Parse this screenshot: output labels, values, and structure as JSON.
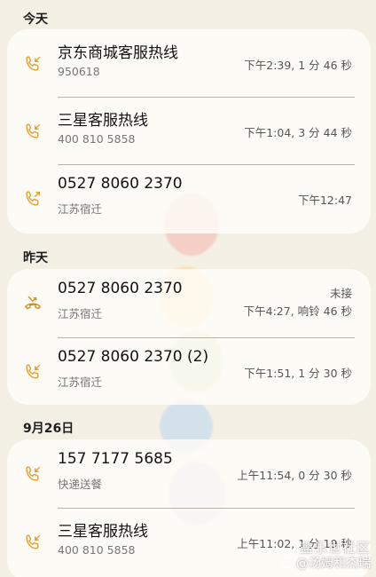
{
  "colors": {
    "background": "#f5f0e6",
    "card": "#fffdf8",
    "call_icon": "#e4a238",
    "missed_icon": "#d6902a"
  },
  "sections": [
    {
      "header": "今天",
      "calls": [
        {
          "name": "京东商城客服热线",
          "sub": "950618",
          "time": "下午2:39, 1 分 46 秒",
          "icon": "incoming-call-icon"
        },
        {
          "name": "三星客服热线",
          "sub": "400 810 5858",
          "time": "下午1:04, 3 分 44 秒",
          "icon": "incoming-call-icon"
        },
        {
          "name": "0527 8060 2370",
          "sub": "江苏宿迁",
          "time": "下午12:47",
          "icon": "outgoing-call-icon"
        }
      ]
    },
    {
      "header": "昨天",
      "calls": [
        {
          "name": "0527 8060 2370",
          "sub": "江苏宿迁",
          "status": "未接",
          "time": "下午4:27, 响铃 46 秒",
          "icon": "missed-call-icon"
        },
        {
          "name": "0527 8060 2370 (2)",
          "sub": "江苏宿迁",
          "time": "下午1:51, 1 分 30 秒",
          "icon": "incoming-call-icon"
        }
      ]
    },
    {
      "header": "9月26日",
      "calls": [
        {
          "name": "157 7177 5685",
          "sub": "快递送餐",
          "time": "上午11:54, 0 分 30 秒",
          "icon": "incoming-call-icon"
        },
        {
          "name": "三星客服热线",
          "sub": "400 810 5858",
          "time": "上午11:02, 1 分 19 秒",
          "icon": "incoming-call-icon"
        }
      ]
    }
  ],
  "watermark": {
    "line1": "盖乐世社区",
    "line2": "@汤姆和杰瑞"
  }
}
